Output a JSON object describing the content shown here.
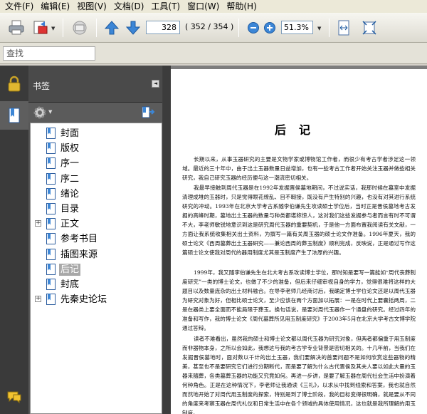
{
  "menubar": {
    "items": [
      "文件(F)",
      "编辑(E)",
      "视图(V)",
      "文档(D)",
      "工具(T)",
      "窗口(W)",
      "帮助(H)"
    ]
  },
  "toolbar": {
    "current_page": "328",
    "page_count": "( 352 / 354 )",
    "zoom": "51.3%",
    "icons": [
      "print-icon",
      "export-icon",
      "mail-icon",
      "previous-page-icon",
      "next-page-icon",
      "zoom-out-icon",
      "zoom-in-icon",
      "fit-width-icon",
      "fit-page-icon"
    ]
  },
  "findbar": {
    "placeholder": "查找"
  },
  "sidebar": {
    "title": "书签",
    "bookmarks": [
      {
        "label": "封面",
        "expandable": false
      },
      {
        "label": "版权",
        "expandable": false
      },
      {
        "label": "序一",
        "expandable": false
      },
      {
        "label": "序二",
        "expandable": false
      },
      {
        "label": "绪论",
        "expandable": false
      },
      {
        "label": "目录",
        "expandable": false
      },
      {
        "label": "正文",
        "expandable": true
      },
      {
        "label": "参考书目",
        "expandable": false
      },
      {
        "label": "插图来源",
        "expandable": false
      },
      {
        "label": "后记",
        "expandable": false,
        "selected": true
      },
      {
        "label": "封底",
        "expandable": false
      },
      {
        "label": "先秦史论坛",
        "expandable": true
      }
    ]
  },
  "document": {
    "heading": "后记",
    "paragraphs": [
      "长期以来，从事玉器研究的主要是文物学家或博物馆工作者，而很少有考古学者涉足这一领域。最近的三十年中，由于出土玉器数量日益增加，也有一些考古工作者开始关注玉器并做些相关研究，我自己研究玉器的经历便与这一潮流密切相关。",
      "我最早接触到周代玉器是在1992年发掘晋侯墓地期间，不过说实话，我那时候在墓室中发掘清理成堆的玉器时，只是觉得眼花缭乱、目不暇接，既没有产生特别的兴趣，也没有对其进行系统研究的冲动。1993年在北京大学考古系随李伯谦先生攻读硕士学位后，当时正是晋侯墓地考古发掘的高峰时期，墓地出土玉器的数量与种类都堪称惊人，这对我们这些发掘参与者而言有时不可谓不大，李老师敏锐地意识到这是研究周代玉器的重要契机，于是他一方面布置我阅读有关文献，一方面让我系统收集相关出土资料，为撰写一篇有关周玉器的硕士论文作准备。1996年夏天，我的硕士论文《西周墓葬出土玉器研究——兼论西周的葬玉制度》顺利完成，反映说，正是通过写作这篇硕士论文使我对周代的器用制度尤其是玉制度产生了浓厚的兴趣。",
      "1999年，我又随李伯谦先生在北大考古系攻读博士学位，那时知是要写一篇能如“周代丧葬制度研究”一类的博士论文，也做了不少的准备，但后来仔细审视自身的学力，觉得很难将这样的大题目以及数量庞杂的出土材料融合。在导李老师几经商讨后，我确定博士学位论文还是以周代玉器为研究对象为好，但相比硕士论文，至少应该在两个方面加以拓展：一是在时代上要囊括两周，二是在器类上要全面而不能局限于葬玉。换句话说，是要对周代玉器作一个通盘的研究。经过四年的准备和写作，我的博士论文《周代墓葬所见用玉制度研究》于2003年5月在北京大学考古文博学院通过答辩。",
      "读者不难看出，虽然我的硕士和博士论文都以周代玉器为研究对象，但两者都偏重于用玉制度而非器物本身，之所以会如此，我想这与我的考古学专业背景是密切相关的。十几年前，当我们在发掘晋侯墓地时，面对数以千计的出土玉器，我们要解决的首要问题不是如何欣赏这些器物的精美，甚至也不是要研究它们进行分期断代，而是要了解为什么古代晋侯及其夫人要以如此大量的玉器来随葬，各类墓葬玉器的功能又究竟如何。再进一步讲，是要了解玉器在周代社会生活中扮演着何种角色。正是在这种情况下，李老师让我通读《三礼》，以求从中找到线索和答案，我也就自然而然地开始了对周代用玉制度的探索，特别是到了博士阶段，我的目标变得很明确，就是要从不同的角度来考察玉器在周代礼仪和日常生活中在各个领域的具体使用情况，这也就是我所理解的用玉制度。"
    ]
  }
}
